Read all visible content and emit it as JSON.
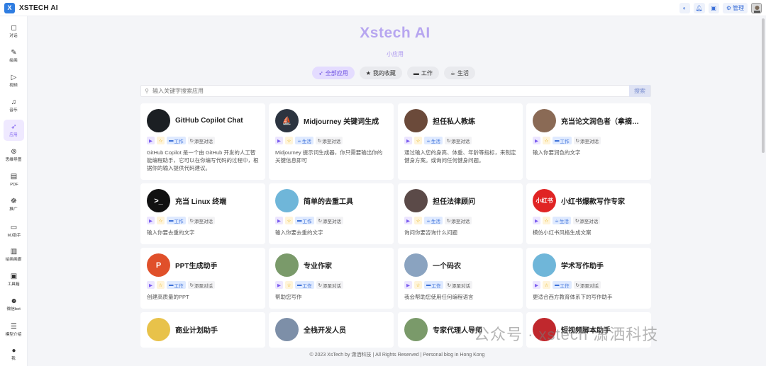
{
  "app": {
    "brand": "XSTECH AI",
    "logo_glyph": "X"
  },
  "topbar": {
    "manage_label": "管理",
    "icons": [
      "theme-icon",
      "bell-icon",
      "gift-icon",
      "gear-icon"
    ]
  },
  "sidebar": {
    "items": [
      {
        "id": "chat",
        "label": "对话",
        "icon": "◻"
      },
      {
        "id": "draw",
        "label": "绘画",
        "icon": "✎"
      },
      {
        "id": "video",
        "label": "视频",
        "icon": "▷"
      },
      {
        "id": "music",
        "label": "音乐",
        "icon": "♫"
      },
      {
        "id": "apps",
        "label": "应用",
        "icon": "➶"
      },
      {
        "id": "mindmap",
        "label": "思维导图",
        "icon": "⊚"
      },
      {
        "id": "pdf",
        "label": "PDF",
        "icon": "▤"
      },
      {
        "id": "promote",
        "label": "推广",
        "icon": "☸"
      },
      {
        "id": "mj",
        "label": "MJ助手",
        "icon": "▭"
      },
      {
        "id": "gallery",
        "label": "绘画画廊",
        "icon": "▥"
      },
      {
        "id": "tools",
        "label": "工具箱",
        "icon": "▣"
      },
      {
        "id": "wechatbot",
        "label": "微信bot",
        "icon": "☻"
      },
      {
        "id": "models",
        "label": "模型介绍",
        "icon": "☰"
      },
      {
        "id": "me",
        "label": "我",
        "icon": "●"
      }
    ]
  },
  "hero": {
    "title": "Xstech AI",
    "subtitle": "小应用"
  },
  "categories": [
    {
      "label": "全部应用",
      "icon": "➶",
      "active": true
    },
    {
      "label": "我的收藏",
      "icon": "★",
      "active": false
    },
    {
      "label": "工作",
      "icon": "▬",
      "active": false
    },
    {
      "label": "生活",
      "icon": "☕",
      "active": false
    }
  ],
  "search": {
    "placeholder": "输入关键字搜索应用",
    "button": "搜索"
  },
  "card_labels": {
    "add": "添至对话"
  },
  "apps": [
    {
      "title": "GitHub Copilot Chat",
      "category": "工作",
      "desc": "GitHub Copilot 是一个由 GitHub 开发的人工智能编程助手，它可以在你编写代码的过程中，根据你的输入提供代码建议。",
      "icon_bg": "#1b1f23",
      "icon_text": ""
    },
    {
      "title": "Midjourney 关键词生成",
      "category": "生活",
      "desc": "Midjourney 提示词生成器，你只需要输出你的关键信息即可",
      "icon_bg": "#2c3440",
      "icon_text": "⛵"
    },
    {
      "title": "担任私人教练",
      "category": "生活",
      "desc": "通过输入您的身高、体重、年龄等指标，来制定健身方案。或询问任何健身问题。",
      "icon_bg": "#6b4a3a",
      "icon_text": ""
    },
    {
      "title": "充当论文润色者（拿摘要部...",
      "category": "工作",
      "desc": "输入你要润色的文字",
      "icon_bg": "#8a6a55",
      "icon_text": ""
    },
    {
      "title": "充当 Linux 终端",
      "category": "工作",
      "desc": "输入你要去重的文字",
      "icon_bg": "#111111",
      "icon_text": ">_"
    },
    {
      "title": "简单的去重工具",
      "category": "工作",
      "desc": "输入你要去重的文字",
      "icon_bg": "#6fb6d9",
      "icon_text": ""
    },
    {
      "title": "担任法律顾问",
      "category": "生活",
      "desc": "询问你要咨询什么问题",
      "icon_bg": "#5b4a48",
      "icon_text": ""
    },
    {
      "title": "小红书爆款写作专家",
      "category": "生活",
      "desc": "模仿小红书风格生成文案",
      "icon_bg": "#e02424",
      "icon_text": "小红书"
    },
    {
      "title": "PPT生成助手",
      "category": "工作",
      "desc": "创建高质量的PPT",
      "icon_bg": "#e0502a",
      "icon_text": "P"
    },
    {
      "title": "专业作家",
      "category": "工作",
      "desc": "帮助您写作",
      "icon_bg": "#7a9a6a",
      "icon_text": ""
    },
    {
      "title": "一个码农",
      "category": "工作",
      "desc": "我会帮助您使用任何编程语言",
      "icon_bg": "#8aa3c0",
      "icon_text": ""
    },
    {
      "title": "学术写作助手",
      "category": "工作",
      "desc": "更适合西方教育体系下的写作助手",
      "icon_bg": "#6fb6d9",
      "icon_text": ""
    },
    {
      "title": "商业计划助手",
      "category": "工作",
      "desc": "",
      "icon_bg": "#e8c24a",
      "icon_text": ""
    },
    {
      "title": "全栈开发人员",
      "category": "工作",
      "desc": "",
      "icon_bg": "#7d8fa8",
      "icon_text": ""
    },
    {
      "title": "专家代理人导师",
      "category": "工作",
      "desc": "",
      "icon_bg": "#7a9a6a",
      "icon_text": ""
    },
    {
      "title": "短视频脚本助手",
      "category": "工作",
      "desc": "",
      "icon_bg": "#c0282d",
      "icon_text": ""
    }
  ],
  "footer": {
    "text": "© 2023 XsTech by 潇洒科技 | All Rights Reserved | Personal blog in Hong Kong"
  },
  "watermark": {
    "text": "公众号 · xstech 潇洒科技"
  }
}
